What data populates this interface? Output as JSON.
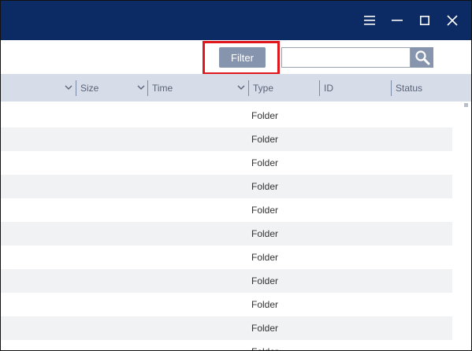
{
  "window": {
    "menu_icon": "hamburger-icon",
    "minimize_icon": "minimize-icon",
    "maximize_icon": "maximize-icon",
    "close_icon": "close-icon"
  },
  "toolbar": {
    "filter_label": "Filter",
    "search_value": "",
    "search_icon": "search-icon"
  },
  "columns": {
    "size": "Size",
    "time": "Time",
    "type": "Type",
    "id": "ID",
    "status": "Status"
  },
  "rows": [
    {
      "type": "Folder"
    },
    {
      "type": "Folder"
    },
    {
      "type": "Folder"
    },
    {
      "type": "Folder"
    },
    {
      "type": "Folder"
    },
    {
      "type": "Folder"
    },
    {
      "type": "Folder"
    },
    {
      "type": "Folder"
    },
    {
      "type": "Folder"
    },
    {
      "type": "Folder"
    },
    {
      "type": "Folder"
    }
  ],
  "colors": {
    "titlebar": "#0c2a63",
    "header": "#d6dce8",
    "button": "#8794ad",
    "highlight": "#e1171e"
  }
}
